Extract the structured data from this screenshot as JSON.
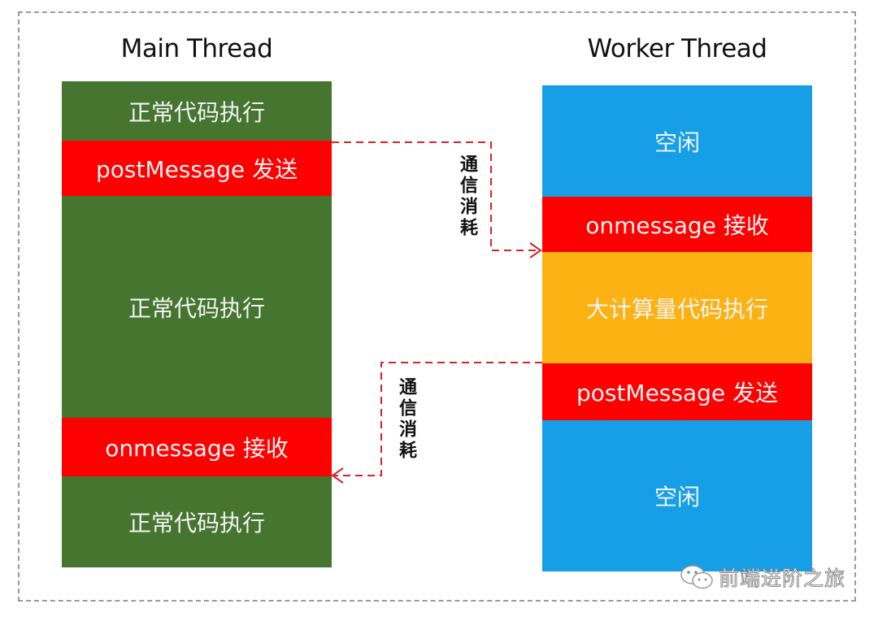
{
  "main_thread": {
    "title": "Main Thread",
    "segments": [
      {
        "label": "正常代码执行",
        "kind": "normal"
      },
      {
        "label": "postMessage 发送",
        "kind": "message"
      },
      {
        "label": "正常代码执行",
        "kind": "normal"
      },
      {
        "label": "onmessage 接收",
        "kind": "message"
      },
      {
        "label": "正常代码执行",
        "kind": "normal"
      }
    ]
  },
  "worker_thread": {
    "title": "Worker Thread",
    "segments": [
      {
        "label": "空闲",
        "kind": "idle"
      },
      {
        "label": "onmessage 接收",
        "kind": "message"
      },
      {
        "label": "大计算量代码执行",
        "kind": "compute"
      },
      {
        "label": "postMessage 发送",
        "kind": "message"
      },
      {
        "label": "空闲",
        "kind": "idle"
      }
    ]
  },
  "arrows": [
    {
      "from": "main_thread.postMessage",
      "to": "worker_thread.onmessage",
      "label": "通信消耗"
    },
    {
      "from": "worker_thread.postMessage",
      "to": "main_thread.onmessage",
      "label": "通信消耗"
    }
  ],
  "colors": {
    "normal": "#467530",
    "message": "#fe0000",
    "idle": "#169fe6",
    "compute": "#fdb213",
    "arrow": "#d0262b",
    "frame": "#9a9a9a"
  },
  "watermark": {
    "text": "前端进阶之旅",
    "icon": "wechat-icon"
  }
}
